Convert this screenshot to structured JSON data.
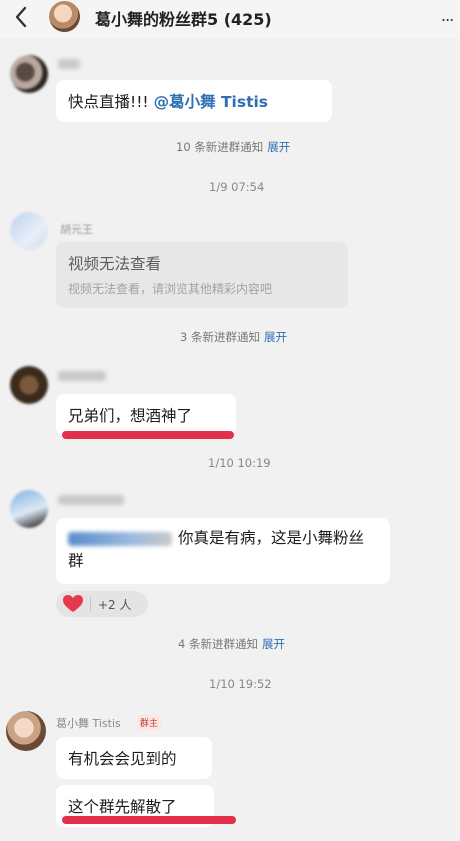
{
  "header": {
    "back_icon": "chevron-left-icon",
    "title": "葛小舞的粉丝群5 (425)",
    "more_icon": "more-dots-icon",
    "more_glyph": "..."
  },
  "messages": {
    "m1": {
      "text": "快点直播!!! ",
      "mention": "@葛小舞 Tistis"
    },
    "n1": {
      "text": "10 条新进群通知",
      "link": "展开"
    },
    "t1": "1/9 07:54",
    "m2": {
      "sender_partial": "胡元王",
      "title": "视频无法查看",
      "subtitle": "视频无法查看，请浏览其他精彩内容吧"
    },
    "n2": {
      "text": "3 条新进群通知",
      "link": "展开"
    },
    "m3": {
      "text": "兄弟们，想酒神了"
    },
    "t2": "1/10 10:19",
    "m4": {
      "text": "你真是有病，这是小舞粉丝群",
      "reaction_count": "+2 人",
      "reaction_icon": "heart-icon"
    },
    "n3": {
      "text": "4 条新进群通知",
      "link": "展开"
    },
    "t3": "1/10 19:52",
    "m5": {
      "sender": "葛小舞 Tistis",
      "tag": "群主",
      "text1": "有机会会见到的",
      "text2": "这个群先解散了"
    }
  },
  "colors": {
    "link": "#2f6fb3",
    "highlight_underline": "#e2304a",
    "background": "#f1f1f1"
  }
}
